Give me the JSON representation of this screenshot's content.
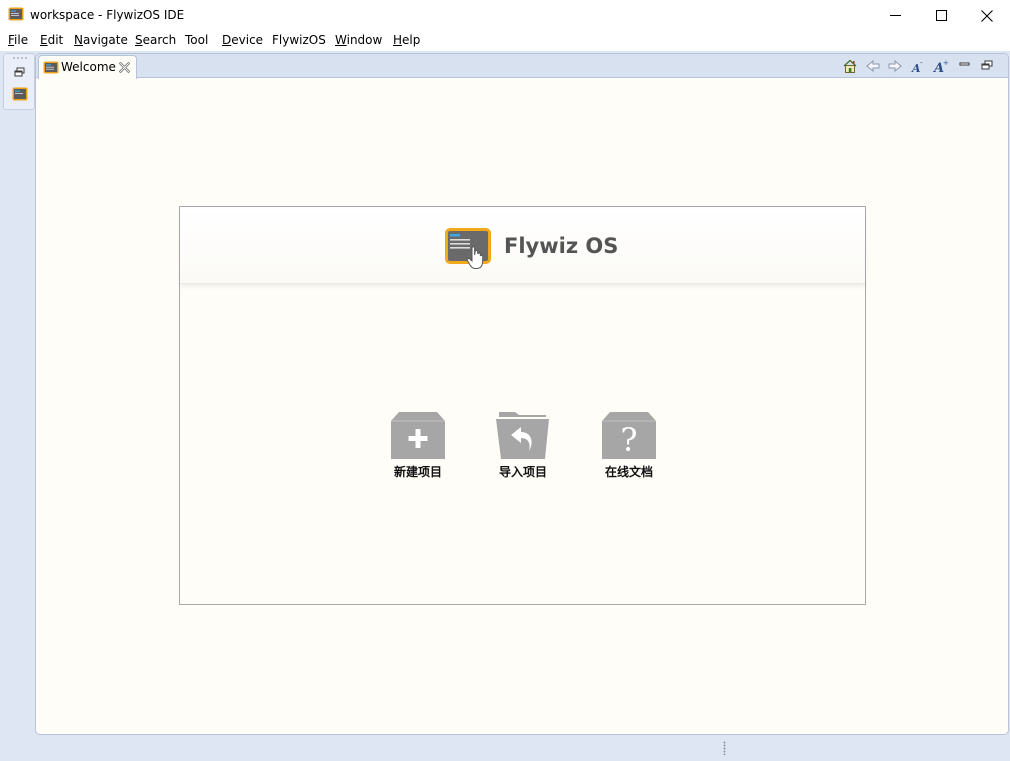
{
  "window": {
    "title": "workspace - FlywizOS IDE",
    "icon": "flywiz-app-icon",
    "controls": [
      "minimize-icon",
      "maximize-icon",
      "close-icon"
    ]
  },
  "menubar": {
    "items": [
      {
        "mnemonic": "F",
        "rest": "ile"
      },
      {
        "mnemonic": "E",
        "rest": "dit"
      },
      {
        "mnemonic": "N",
        "rest": "avigate"
      },
      {
        "mnemonic": "S",
        "rest": "earch"
      },
      {
        "mnemonic": "",
        "rest": "Tool"
      },
      {
        "mnemonic": "D",
        "rest": "evice"
      },
      {
        "mnemonic": "",
        "rest": "FlywizOS"
      },
      {
        "mnemonic": "W",
        "rest": "indow"
      },
      {
        "mnemonic": "H",
        "rest": "elp"
      }
    ]
  },
  "editor": {
    "tab": {
      "label": "Welcome",
      "icon": "welcome-icon",
      "close_icon": "close-tab-icon"
    },
    "toolbar_icons": [
      "home-icon",
      "back-icon",
      "forward-icon",
      "decrease-font-icon",
      "increase-font-icon",
      "minimize-view-icon",
      "restore-view-icon"
    ]
  },
  "welcome": {
    "brand": "Flywiz OS",
    "actions": [
      {
        "label": "新建项目",
        "icon": "new-project-icon"
      },
      {
        "label": "导入项目",
        "icon": "import-project-icon"
      },
      {
        "label": "在线文档",
        "icon": "online-docs-icon"
      }
    ]
  },
  "colors": {
    "workbench": "#dfe6f3",
    "editor_bg": "#fffdf8",
    "action_icon": "#a6a6a6",
    "brand_text": "#545454",
    "logo_frame": "#f0a91b"
  }
}
